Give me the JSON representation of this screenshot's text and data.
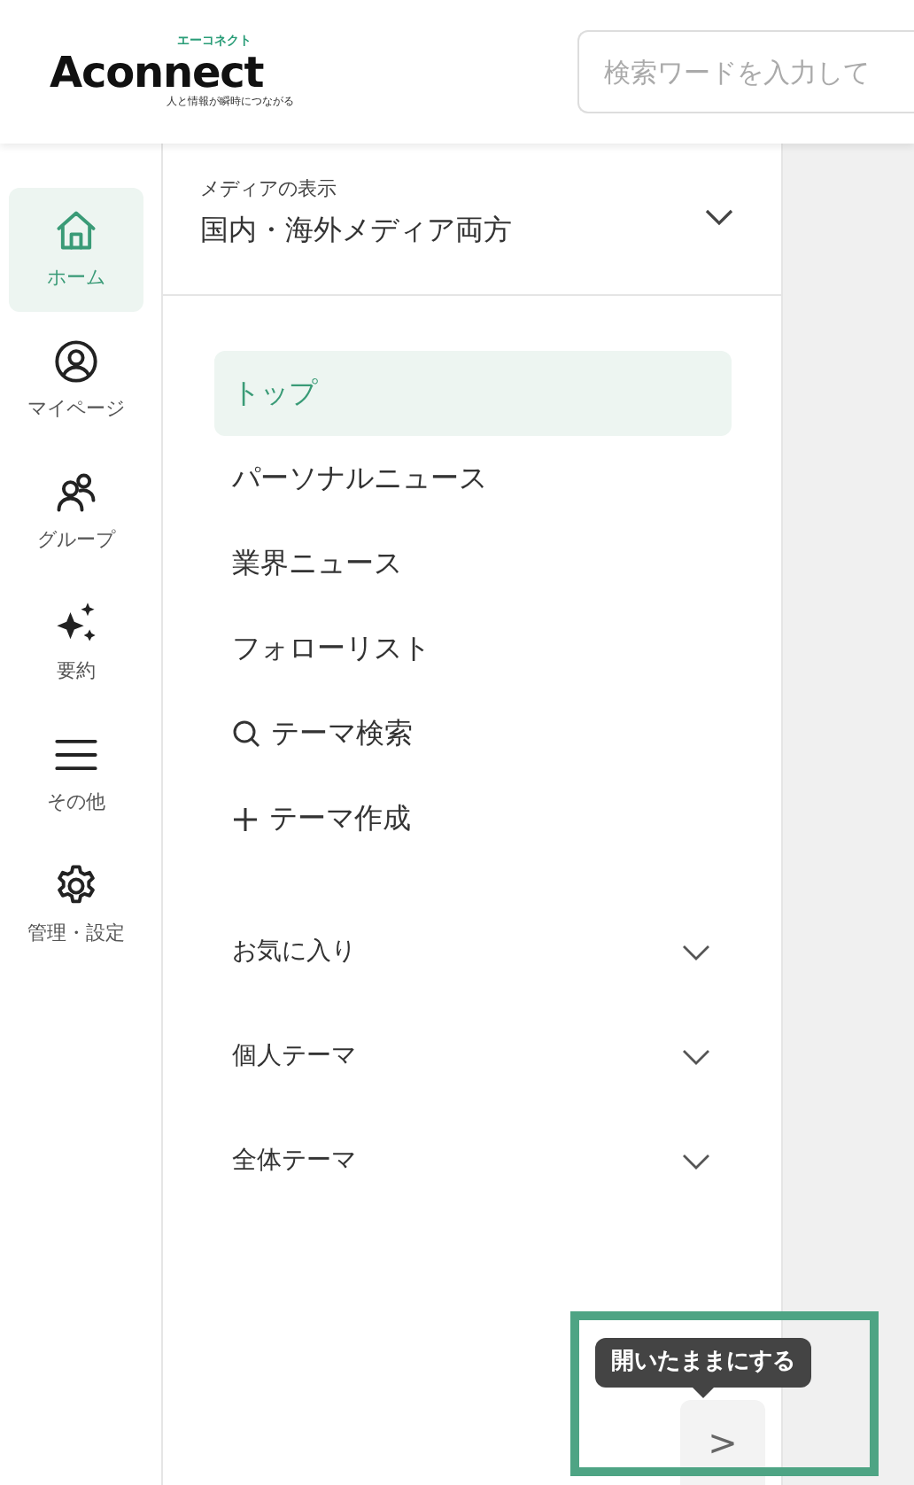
{
  "header": {
    "logo": {
      "name": "Aconnect",
      "kana": "エーコネクト",
      "tagline": "人と情報が瞬時につながる"
    },
    "search": {
      "placeholder": "検索ワードを入力して"
    }
  },
  "rail": [
    {
      "label": "ホーム",
      "selected": true
    },
    {
      "label": "マイページ",
      "selected": false
    },
    {
      "label": "グループ",
      "selected": false
    },
    {
      "label": "要約",
      "selected": false
    },
    {
      "label": "その他",
      "selected": false
    },
    {
      "label": "管理・設定",
      "selected": false
    }
  ],
  "media": {
    "label": "メディアの表示",
    "value": "国内・海外メディア両方"
  },
  "menu": [
    {
      "label": "トップ",
      "kind": "page",
      "selected": true
    },
    {
      "label": "パーソナルニュース",
      "kind": "page",
      "selected": false
    },
    {
      "label": "業界ニュース",
      "kind": "page",
      "selected": false
    },
    {
      "label": "フォローリスト",
      "kind": "page",
      "selected": false
    },
    {
      "label": "テーマ検索",
      "kind": "search",
      "selected": false
    },
    {
      "label": "テーマ作成",
      "kind": "create",
      "selected": false
    }
  ],
  "sections": [
    {
      "label": "お気に入り",
      "expanded": false
    },
    {
      "label": "個人テーマ",
      "expanded": false
    },
    {
      "label": "全体テーマ",
      "expanded": false
    }
  ],
  "tooltip": "開いたままにする",
  "expand_button": ">"
}
